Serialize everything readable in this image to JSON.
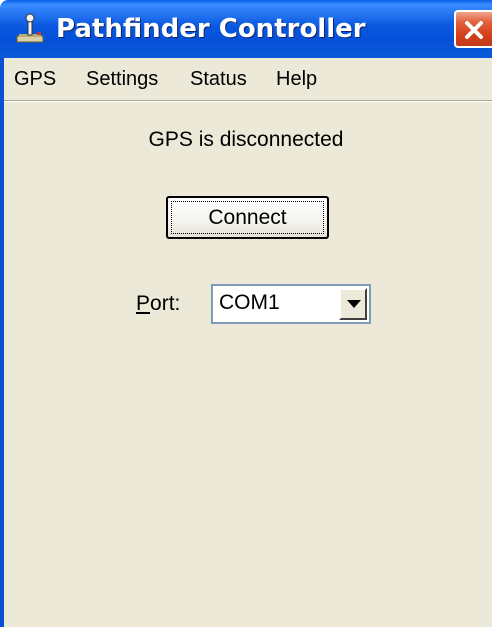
{
  "window": {
    "title": "Pathfinder Controller",
    "title_icon": "joystick-icon",
    "close_icon": "close-icon"
  },
  "menu": {
    "items": [
      {
        "label": "GPS"
      },
      {
        "label": "Settings"
      },
      {
        "label": "Status"
      },
      {
        "label": "Help"
      }
    ]
  },
  "main": {
    "status_text": "GPS is disconnected",
    "connect_label": "Connect",
    "port": {
      "label_accel": "P",
      "label_rest": "ort:",
      "value": "COM1",
      "dropdown_icon": "chevron-down-icon"
    }
  },
  "colors": {
    "titlebar": "#0a58e0",
    "window_bg": "#ece9d8",
    "close_button": "#d23e18",
    "border": "#0a4fd4"
  }
}
